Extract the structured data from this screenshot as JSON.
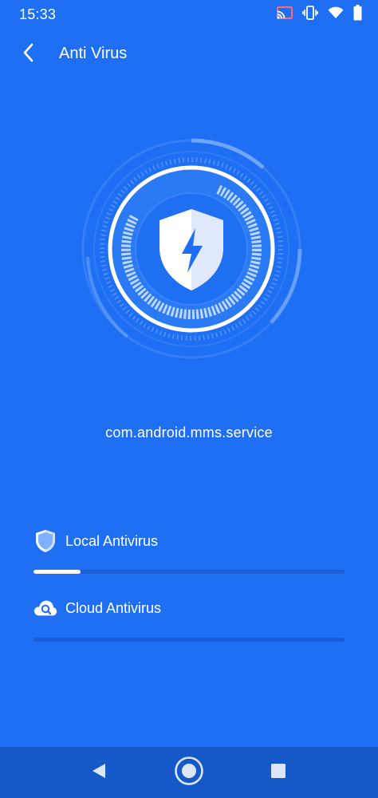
{
  "status_bar": {
    "time": "15:33",
    "icons": [
      "cast-icon",
      "vibrate-icon",
      "wifi-icon",
      "battery-icon"
    ]
  },
  "header": {
    "title": "Anti Virus",
    "back_icon": "chevron-left-icon"
  },
  "scan": {
    "current_item": "com.android.mms.service",
    "center_icon": "shield-bolt-icon"
  },
  "engines": [
    {
      "label": "Local Antivirus",
      "icon": "shield-icon",
      "progress": 0.15
    },
    {
      "label": "Cloud Antivirus",
      "icon": "cloud-search-icon",
      "progress": 0
    }
  ],
  "nav": {
    "buttons": [
      "back-triangle-icon",
      "home-circle-icon",
      "recents-square-icon"
    ]
  },
  "colors": {
    "background": "#1e6ff3",
    "nav_bar": "#1559c8",
    "track": "#1a5ed4",
    "accent_white": "#ffffff"
  }
}
